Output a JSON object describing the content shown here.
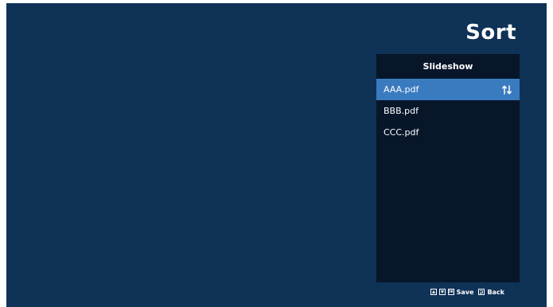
{
  "page": {
    "title": "Sort"
  },
  "panel": {
    "header": "Slideshow",
    "files": [
      {
        "name": "AAA.pdf",
        "selected": true
      },
      {
        "name": "BBB.pdf",
        "selected": false
      },
      {
        "name": "CCC.pdf",
        "selected": false
      }
    ]
  },
  "footer": {
    "ok_key": "OK",
    "save_label": "Save",
    "back_label": "Back"
  },
  "icons": {
    "sort": "sort-arrows-icon",
    "up_key": "arrow-up-key-icon",
    "down_key": "arrow-down-key-icon",
    "ok_key": "ok-key-icon",
    "back_key": "back-key-icon"
  },
  "colors": {
    "background": "#0f3257",
    "panel": "#08162a",
    "selection": "#3a7bc0",
    "text": "#ffffff"
  }
}
